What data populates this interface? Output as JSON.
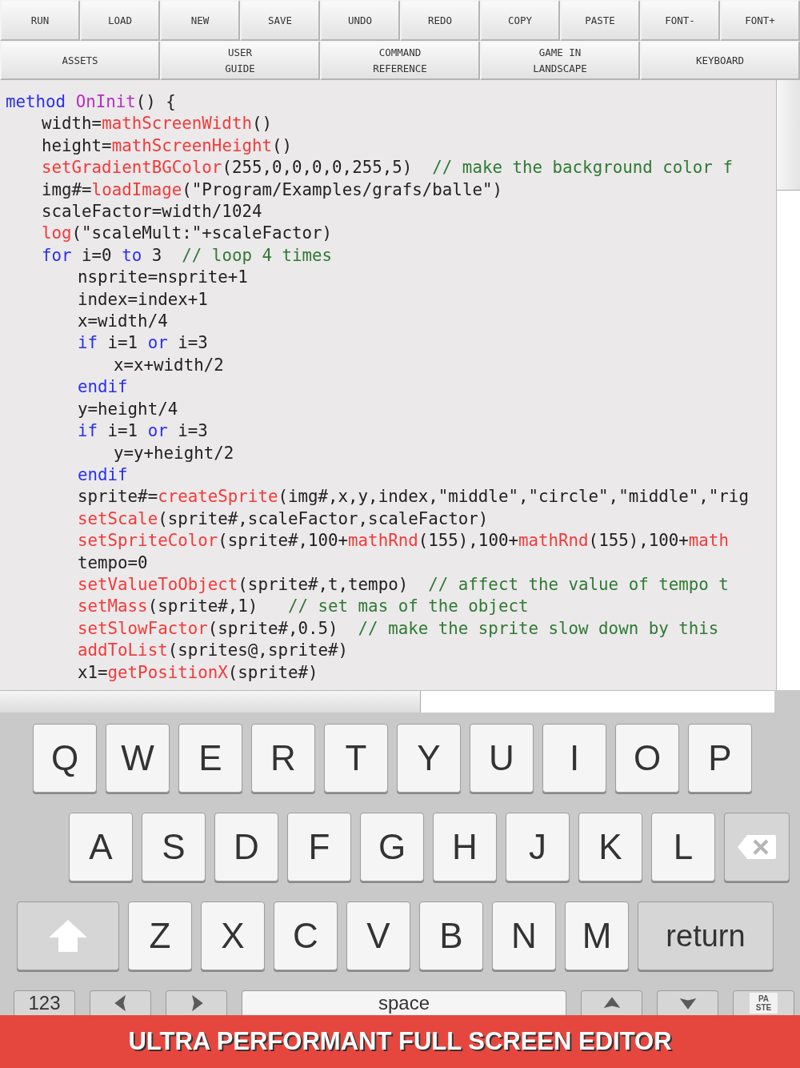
{
  "toolbar_row_1": [
    "RUN",
    "LOAD",
    "NEW",
    "SAVE",
    "UNDO",
    "REDO",
    "COPY",
    "PASTE",
    "FONT-",
    "FONT+"
  ],
  "toolbar_row_2": [
    "ASSETS",
    "USER\nGUIDE",
    "COMMAND\nREFERENCE",
    "GAME IN\nLANDSCAPE",
    "KEYBOARD"
  ],
  "code": [
    {
      "tokens": [
        {
          "kind": "keyword",
          "text": "method "
        },
        {
          "kind": "name",
          "text": "OnInit"
        },
        {
          "kind": "text",
          "text": "() {"
        }
      ],
      "children": [
        {
          "tokens": [
            {
              "kind": "text",
              "text": "width="
            },
            {
              "kind": "call",
              "text": "mathScreenWidth"
            },
            {
              "kind": "text",
              "text": "()"
            }
          ]
        },
        {
          "tokens": [
            {
              "kind": "text",
              "text": "height="
            },
            {
              "kind": "call",
              "text": "mathScreenHeight"
            },
            {
              "kind": "text",
              "text": "()"
            }
          ]
        },
        {
          "tokens": [
            {
              "kind": "call",
              "text": "setGradientBGColor"
            },
            {
              "kind": "text",
              "text": "(255,0,0,0,0,255,5)  "
            },
            {
              "kind": "comment",
              "text": "// make the background color f"
            }
          ]
        },
        {
          "tokens": [
            {
              "kind": "text",
              "text": "img#="
            },
            {
              "kind": "call",
              "text": "loadImage"
            },
            {
              "kind": "text",
              "text": "(\"Program/Examples/grafs/balle\")"
            }
          ]
        },
        {
          "tokens": [
            {
              "kind": "text",
              "text": "scaleFactor=width/1024"
            }
          ]
        },
        {
          "tokens": [
            {
              "kind": "call",
              "text": "log"
            },
            {
              "kind": "text",
              "text": "(\"scaleMult:\"+scaleFactor)"
            }
          ]
        },
        {
          "tokens": [
            {
              "kind": "keyword",
              "text": "for"
            },
            {
              "kind": "text",
              "text": " i=0 "
            },
            {
              "kind": "keyword",
              "text": "to"
            },
            {
              "kind": "text",
              "text": " 3  "
            },
            {
              "kind": "comment",
              "text": "// loop 4 times"
            }
          ],
          "children": [
            {
              "tokens": [
                {
                  "kind": "text",
                  "text": "nsprite=nsprite+1"
                }
              ]
            },
            {
              "tokens": [
                {
                  "kind": "text",
                  "text": "index=index+1"
                }
              ]
            },
            {
              "tokens": [
                {
                  "kind": "text",
                  "text": "x=width/4"
                }
              ]
            },
            {
              "tokens": [
                {
                  "kind": "keyword",
                  "text": "if"
                },
                {
                  "kind": "text",
                  "text": " i=1 "
                },
                {
                  "kind": "keyword",
                  "text": "or"
                },
                {
                  "kind": "text",
                  "text": " i=3"
                }
              ],
              "children": [
                {
                  "tokens": [
                    {
                      "kind": "text",
                      "text": "x=x+width/2"
                    }
                  ]
                }
              ]
            },
            {
              "tokens": [
                {
                  "kind": "keyword",
                  "text": "endif"
                }
              ]
            },
            {
              "tokens": [
                {
                  "kind": "text",
                  "text": "y=height/4"
                }
              ]
            },
            {
              "tokens": [
                {
                  "kind": "keyword",
                  "text": "if"
                },
                {
                  "kind": "text",
                  "text": " i=1 "
                },
                {
                  "kind": "keyword",
                  "text": "or"
                },
                {
                  "kind": "text",
                  "text": " i=3"
                }
              ],
              "children": [
                {
                  "tokens": [
                    {
                      "kind": "text",
                      "text": "y=y+height/2"
                    }
                  ]
                }
              ]
            },
            {
              "tokens": [
                {
                  "kind": "keyword",
                  "text": "endif"
                }
              ]
            },
            {
              "tokens": [
                {
                  "kind": "text",
                  "text": "sprite#="
                },
                {
                  "kind": "call",
                  "text": "createSprite"
                },
                {
                  "kind": "text",
                  "text": "(img#,x,y,index,\"middle\",\"circle\",\"middle\",\"rig"
                }
              ]
            },
            {
              "tokens": [
                {
                  "kind": "call",
                  "text": "setScale"
                },
                {
                  "kind": "text",
                  "text": "(sprite#,scaleFactor,scaleFactor)"
                }
              ]
            },
            {
              "tokens": [
                {
                  "kind": "call",
                  "text": "setSpriteColor"
                },
                {
                  "kind": "text",
                  "text": "(sprite#,100+"
                },
                {
                  "kind": "call",
                  "text": "mathRnd"
                },
                {
                  "kind": "text",
                  "text": "(155),100+"
                },
                {
                  "kind": "call",
                  "text": "mathRnd"
                },
                {
                  "kind": "text",
                  "text": "(155),100+"
                },
                {
                  "kind": "call",
                  "text": "math"
                }
              ]
            },
            {
              "tokens": [
                {
                  "kind": "text",
                  "text": "tempo=0"
                }
              ]
            },
            {
              "tokens": [
                {
                  "kind": "call",
                  "text": "setValueToObject"
                },
                {
                  "kind": "text",
                  "text": "(sprite#,t,tempo)  "
                },
                {
                  "kind": "comment",
                  "text": "// affect the value of tempo t"
                }
              ]
            },
            {
              "tokens": [
                {
                  "kind": "call",
                  "text": "setMass"
                },
                {
                  "kind": "text",
                  "text": "(sprite#,1)   "
                },
                {
                  "kind": "comment",
                  "text": "// set mas of the object"
                }
              ]
            },
            {
              "tokens": [
                {
                  "kind": "call",
                  "text": "setSlowFactor"
                },
                {
                  "kind": "text",
                  "text": "(sprite#,0.5)  "
                },
                {
                  "kind": "comment",
                  "text": "// make the sprite slow down by this"
                }
              ]
            },
            {
              "tokens": [
                {
                  "kind": "call",
                  "text": "addToList"
                },
                {
                  "kind": "text",
                  "text": "(sprites@,sprite#)"
                }
              ]
            },
            {
              "tokens": [
                {
                  "kind": "text",
                  "text": "x1="
                },
                {
                  "kind": "call",
                  "text": "getPositionX"
                },
                {
                  "kind": "text",
                  "text": "(sprite#)"
                }
              ]
            }
          ]
        }
      ]
    }
  ],
  "keyboard": [
    [
      {
        "kind": "letter",
        "label": "Q"
      },
      {
        "kind": "letter",
        "label": "W"
      },
      {
        "kind": "letter",
        "label": "E"
      },
      {
        "kind": "letter",
        "label": "R"
      },
      {
        "kind": "letter",
        "label": "T"
      },
      {
        "kind": "letter",
        "label": "Y"
      },
      {
        "kind": "letter",
        "label": "U"
      },
      {
        "kind": "letter",
        "label": "I"
      },
      {
        "kind": "letter",
        "label": "O"
      },
      {
        "kind": "letter",
        "label": "P"
      }
    ],
    [
      {
        "kind": "letter",
        "label": "A"
      },
      {
        "kind": "letter",
        "label": "S"
      },
      {
        "kind": "letter",
        "label": "D"
      },
      {
        "kind": "letter",
        "label": "F"
      },
      {
        "kind": "letter",
        "label": "G"
      },
      {
        "kind": "letter",
        "label": "H"
      },
      {
        "kind": "letter",
        "label": "J"
      },
      {
        "kind": "letter",
        "label": "K"
      },
      {
        "kind": "letter",
        "label": "L"
      },
      {
        "kind": "backspace"
      }
    ],
    [
      {
        "kind": "shift"
      },
      {
        "kind": "letter",
        "label": "Z"
      },
      {
        "kind": "letter",
        "label": "X"
      },
      {
        "kind": "letter",
        "label": "C"
      },
      {
        "kind": "letter",
        "label": "V"
      },
      {
        "kind": "letter",
        "label": "B"
      },
      {
        "kind": "letter",
        "label": "N"
      },
      {
        "kind": "letter",
        "label": "M"
      },
      {
        "kind": "return",
        "label": "return"
      }
    ],
    [
      {
        "kind": "numbers",
        "label": "123"
      },
      {
        "kind": "left"
      },
      {
        "kind": "right"
      },
      {
        "kind": "space",
        "label": "space"
      },
      {
        "kind": "up"
      },
      {
        "kind": "down"
      },
      {
        "kind": "paste",
        "label": "PA\nSTE"
      }
    ]
  ],
  "banner": "ULTRA PERFORMANT FULL SCREEN EDITOR"
}
